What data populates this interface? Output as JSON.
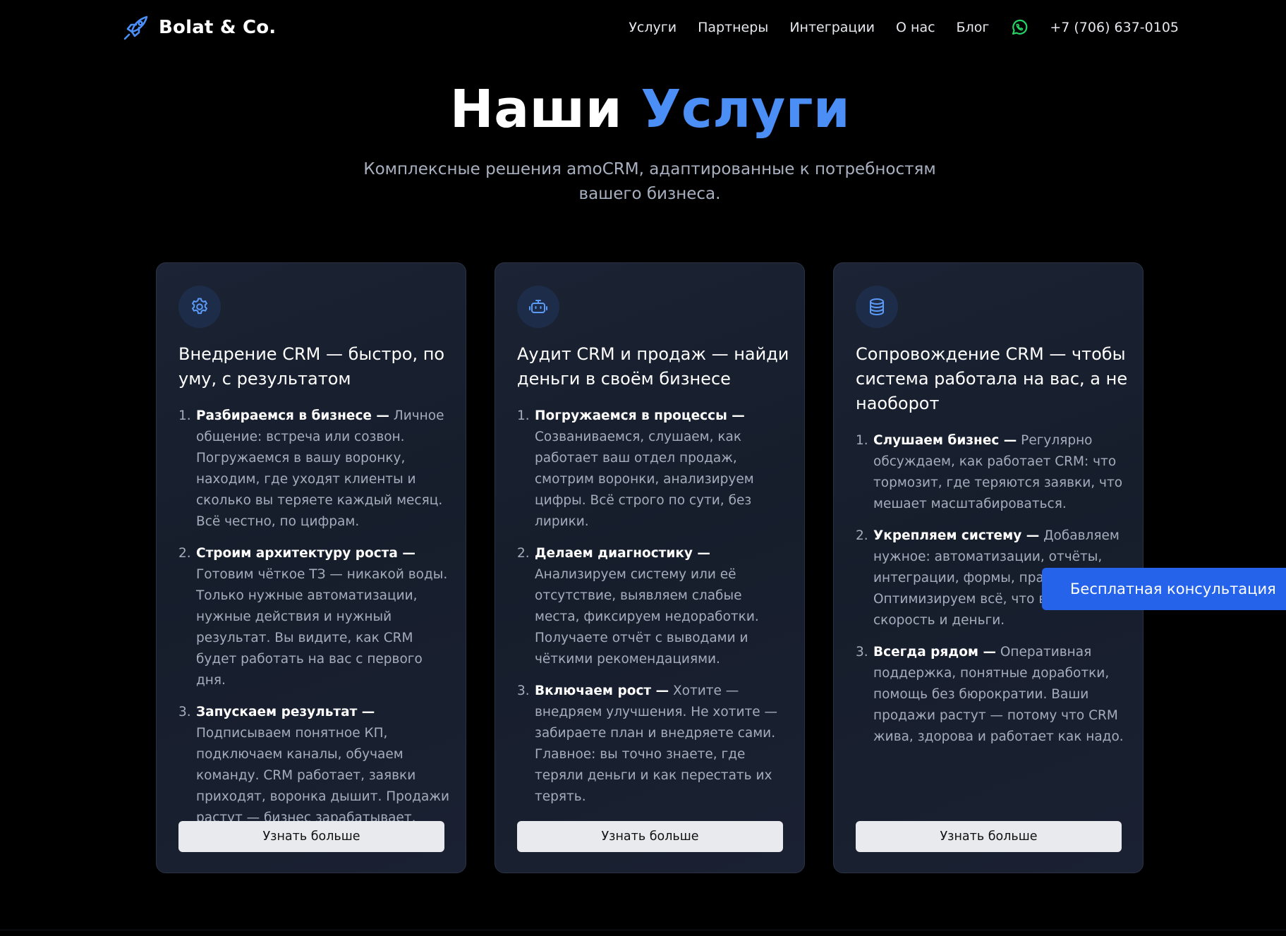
{
  "header": {
    "brand": "Bolat & Co.",
    "logo_icon": "rocket-icon",
    "nav": [
      {
        "label": "Услуги"
      },
      {
        "label": "Партнеры"
      },
      {
        "label": "Интеграции"
      },
      {
        "label": "О нас"
      },
      {
        "label": "Блог"
      }
    ],
    "whatsapp_icon": "whatsapp-icon",
    "phone": "+7 (706) 637-0105"
  },
  "hero": {
    "title_main": "Наши ",
    "title_accent": "Услуги",
    "subtitle": "Комплексные решения amoCRM, адаптированные к потребностям вашего бизнеса."
  },
  "cards": [
    {
      "icon": "gear-icon",
      "title": "Внедрение CRM — быстро, по уму, с результатом",
      "steps": [
        {
          "num": "1.",
          "head": "Разбираемся в бизнесе —",
          "text": " Личное общение: встреча или созвон. Погружаемся в вашу воронку, находим, где уходят клиенты и сколько вы теряете каждый месяц. Всё честно, по цифрам."
        },
        {
          "num": "2.",
          "head": "Строим архитектуру роста —",
          "text": " Готовим чёткое ТЗ — никакой воды. Только нужные автоматизации, нужные действия и нужный результат. Вы видите, как CRM будет работать на вас с первого дня."
        },
        {
          "num": "3.",
          "head": "Запускаем результат —",
          "text": " Подписываем понятное КП, подключаем каналы, обучаем команду. CRM работает, заявки приходят, воронка дышит. Продажи растут — бизнес зарабатывает."
        }
      ],
      "button": "Узнать больше"
    },
    {
      "icon": "robot-icon",
      "title": "Аудит CRM и продаж — найди деньги в своём бизнесе",
      "steps": [
        {
          "num": "1.",
          "head": "Погружаемся в процессы —",
          "text": " Созваниваемся, слушаем, как работает ваш отдел продаж, смотрим воронки, анализируем цифры. Всё строго по сути, без лирики."
        },
        {
          "num": "2.",
          "head": "Делаем диагностику —",
          "text": " Анализируем систему или её отсутствие, выявляем слабые места, фиксируем недоработки. Получаете отчёт с выводами и чёткими рекомендациями."
        },
        {
          "num": "3.",
          "head": "Включаем рост —",
          "text": " Хотите — внедряем улучшения. Не хотите — забираете план и внедряете сами. Главное: вы точно знаете, где теряли деньги и как перестать их терять."
        }
      ],
      "button": "Узнать больше"
    },
    {
      "icon": "database-icon",
      "title": "Сопровождение CRM — чтобы система работала на вас, а не наоборот",
      "steps": [
        {
          "num": "1.",
          "head": "Слушаем бизнес —",
          "text": " Регулярно обсуждаем, как работает CRM: что тормозит, где теряются заявки, что мешает масштабироваться."
        },
        {
          "num": "2.",
          "head": "Укрепляем систему —",
          "text": " Добавляем нужное: автоматизации, отчёты, интеграции, формы, права. Оптимизируем всё, что влияет на скорость и деньги."
        },
        {
          "num": "3.",
          "head": "Всегда рядом —",
          "text": " Оперативная поддержка, понятные доработки, помощь без бюрократии. Ваши продажи растут — потому что CRM жива, здорова и работает как надо."
        }
      ],
      "button": "Узнать больше"
    }
  ],
  "floating_cta": "Бесплатная консультация",
  "colors": {
    "accent": "#4b8ef5",
    "cta": "#2563eb",
    "whatsapp": "#25d366"
  }
}
